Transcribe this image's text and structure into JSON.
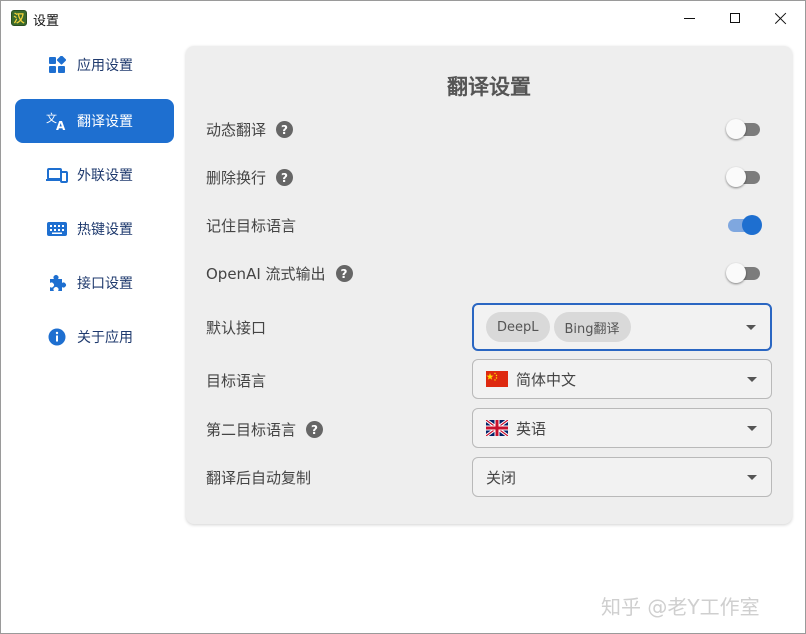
{
  "window": {
    "title": "设置",
    "app_icon_glyph": "汉",
    "controls": {
      "minimize": "minimize-icon",
      "maximize": "maximize-icon",
      "close": "close-icon"
    }
  },
  "sidebar": {
    "accent_color": "#1e6fd0",
    "items": [
      {
        "label": "应用设置",
        "icon": "apps-icon",
        "active": false
      },
      {
        "label": "翻译设置",
        "icon": "translate-icon",
        "active": true
      },
      {
        "label": "外联设置",
        "icon": "devices-icon",
        "active": false
      },
      {
        "label": "热键设置",
        "icon": "keyboard-icon",
        "active": false
      },
      {
        "label": "接口设置",
        "icon": "puzzle-icon",
        "active": false
      },
      {
        "label": "关于应用",
        "icon": "info-icon",
        "active": false
      }
    ]
  },
  "panel": {
    "title": "翻译设置",
    "toggles": [
      {
        "label": "动态翻译",
        "help": true,
        "on": false
      },
      {
        "label": "删除换行",
        "help": true,
        "on": false
      },
      {
        "label": "记住目标语言",
        "help": false,
        "on": true
      },
      {
        "label": "OpenAI 流式输出",
        "help": true,
        "on": false
      }
    ],
    "help_glyph": "?",
    "default_api": {
      "label": "默认接口",
      "chips": [
        "DeepL",
        "Bing翻译"
      ]
    },
    "target_language": {
      "label": "目标语言",
      "value": "简体中文",
      "flag": "cn-flag"
    },
    "second_target_language": {
      "label": "第二目标语言",
      "help": true,
      "value": "英语",
      "flag": "uk-flag"
    },
    "auto_copy": {
      "label": "翻译后自动复制",
      "value": "关闭"
    }
  },
  "watermark": "知乎 @老Y工作室"
}
